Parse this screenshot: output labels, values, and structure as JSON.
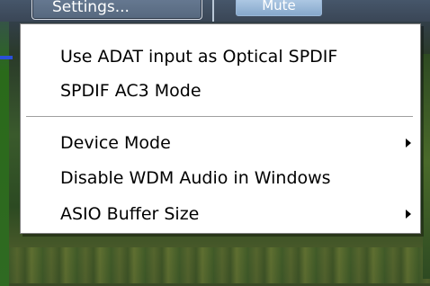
{
  "background": {
    "settings_button_label": "Settings...",
    "mute_button_label": "Mute"
  },
  "context_menu": {
    "items": [
      {
        "label": "Use ADAT input as Optical SPDIF",
        "has_submenu": false
      },
      {
        "label": "SPDIF AC3 Mode",
        "has_submenu": false
      },
      {
        "label": "Device Mode",
        "has_submenu": true,
        "submenu_icon": "chevron-right-icon"
      },
      {
        "label": "Disable WDM Audio in Windows",
        "has_submenu": false
      },
      {
        "label": "ASIO Buffer Size",
        "has_submenu": true,
        "submenu_icon": "chevron-right-icon"
      }
    ]
  },
  "colors": {
    "menu_background": "#ffffff",
    "menu_border": "#808080",
    "text": "#000000",
    "separator": "#a0a0a0"
  }
}
